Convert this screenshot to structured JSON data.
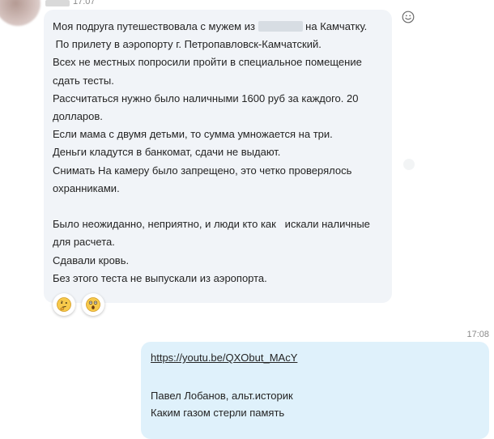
{
  "incoming": {
    "time": "17:07",
    "text_parts": {
      "before_redaction": "Моя подруга путешествовала с мужем из ",
      "after_redaction": " на Камчатку.\n По прилету в аэропорту г. Петропавловск-Камчатский.\nВсех не местных попросили пройти в специальное помещение сдать тесты.\nРассчитаться нужно было наличными 1600 руб за каждого. 20 долларов.\nЕсли мама с двумя детьми, то сумма умножается на три.\nДеньги кладутся в банкомат, сдачи не выдают.\nСнимать На камеру было запрещено, это четко проверялось охранниками.\n\nБыло неожиданно, неприятно, и люди кто как   искали наличные для расчета.\nСдавали кровь.\nБез этого теста не выпускали из аэропорта."
    },
    "reactions": [
      {
        "icon": "thinking-face-icon"
      },
      {
        "icon": "surprised-face-icon"
      }
    ]
  },
  "outgoing": {
    "time": "17:08",
    "link": "https://youtu.be/QXObut_MAcY",
    "lines": [
      "Павел Лобанов, альт.историк",
      "Каким газом стерли память"
    ]
  },
  "colors": {
    "incoming_bubble": "#f1f4f8",
    "outgoing_bubble": "#dff1fb",
    "timestamp": "#8a8a8a"
  }
}
